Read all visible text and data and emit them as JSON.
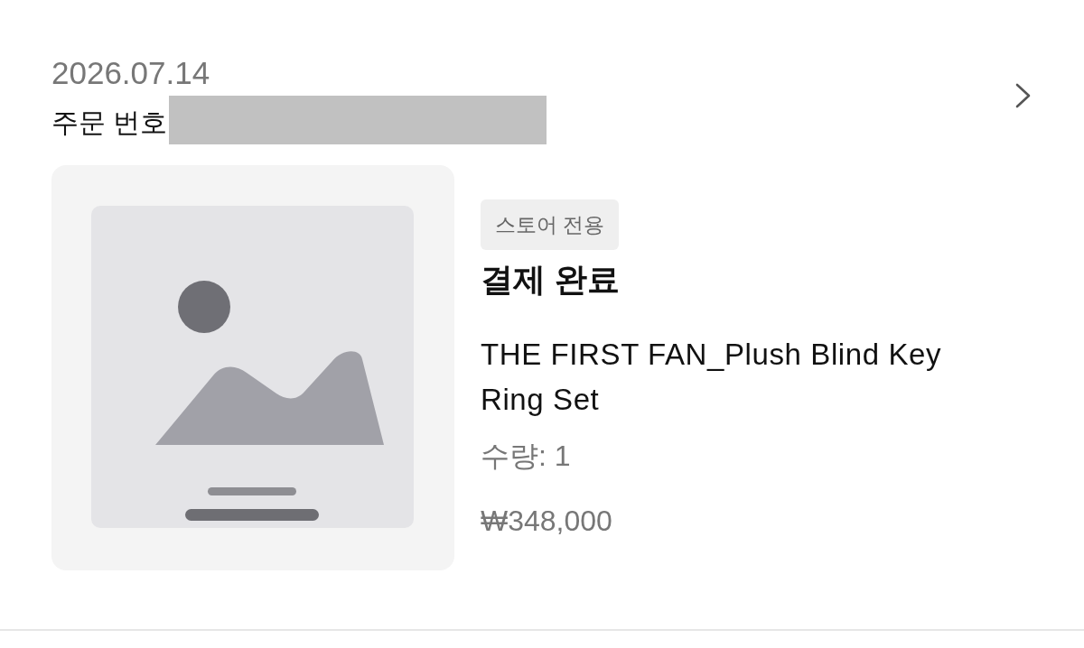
{
  "order": {
    "date": "2026.07.14",
    "number_label": "주문 번호",
    "number_redacted": true
  },
  "item": {
    "badge": "스토어 전용",
    "status": "결제 완료",
    "name": "THE FIRST FAN_Plush Blind Key Ring Set",
    "quantity": "수량: 1",
    "price": "₩348,000"
  }
}
